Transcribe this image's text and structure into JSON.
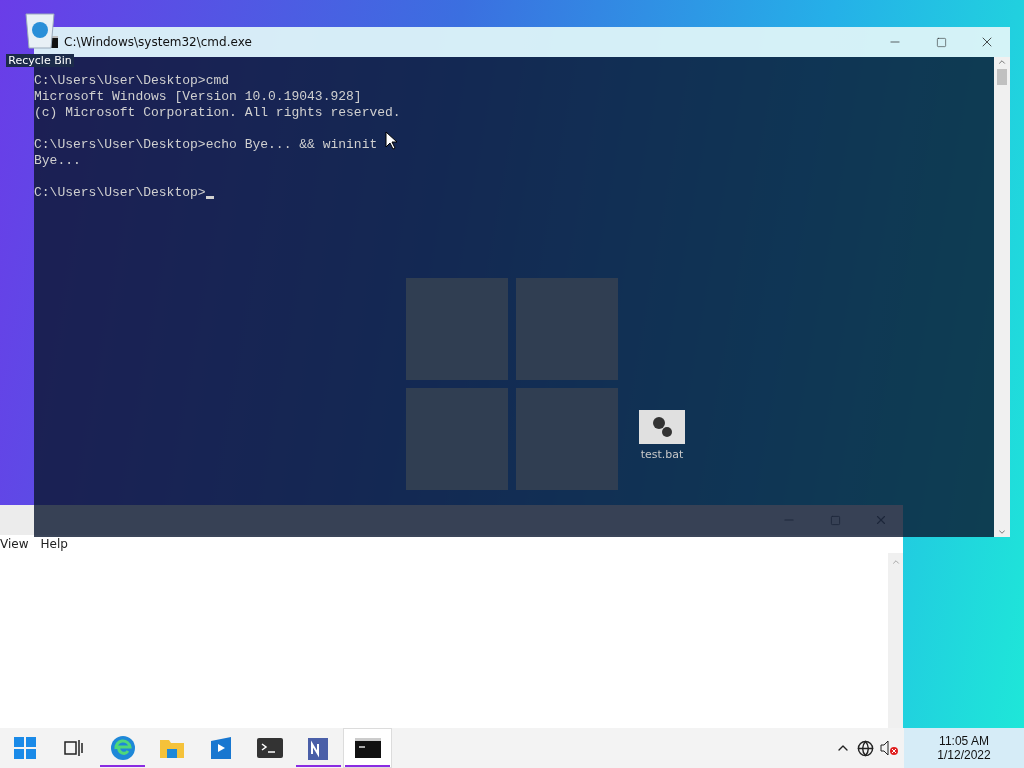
{
  "desktop_icons": [
    {
      "kind": "recycle",
      "label": "Recycle Bin"
    },
    {
      "kind": "batch",
      "label": "test.bat"
    }
  ],
  "notepad": {
    "menu": [
      "View",
      "Help"
    ]
  },
  "cmd": {
    "title": "C:\\Windows\\system32\\cmd.exe",
    "blocks": [
      [
        "C:\\Users\\User\\Desktop>cmd",
        "Microsoft Windows [Version 10.0.19043.928]",
        "(c) Microsoft Corporation. All rights reserved."
      ],
      [
        "C:\\Users\\User\\Desktop>echo Bye... && wininit",
        "Bye..."
      ],
      [
        "C:\\Users\\User\\Desktop>"
      ]
    ],
    "cursor_visible": true
  },
  "taskbar": {
    "items": [
      {
        "kind": "start",
        "running": false,
        "selected": false
      },
      {
        "kind": "taskview",
        "running": false,
        "selected": false
      },
      {
        "kind": "edge",
        "running": true,
        "selected": false
      },
      {
        "kind": "explorer",
        "running": false,
        "selected": false
      },
      {
        "kind": "media",
        "running": false,
        "selected": false
      },
      {
        "kind": "terminal",
        "running": false,
        "selected": false
      },
      {
        "kind": "notepad",
        "running": true,
        "selected": false
      },
      {
        "kind": "cmd",
        "running": true,
        "selected": true
      }
    ],
    "time": "11:05 AM",
    "date": "1/12/2022"
  }
}
